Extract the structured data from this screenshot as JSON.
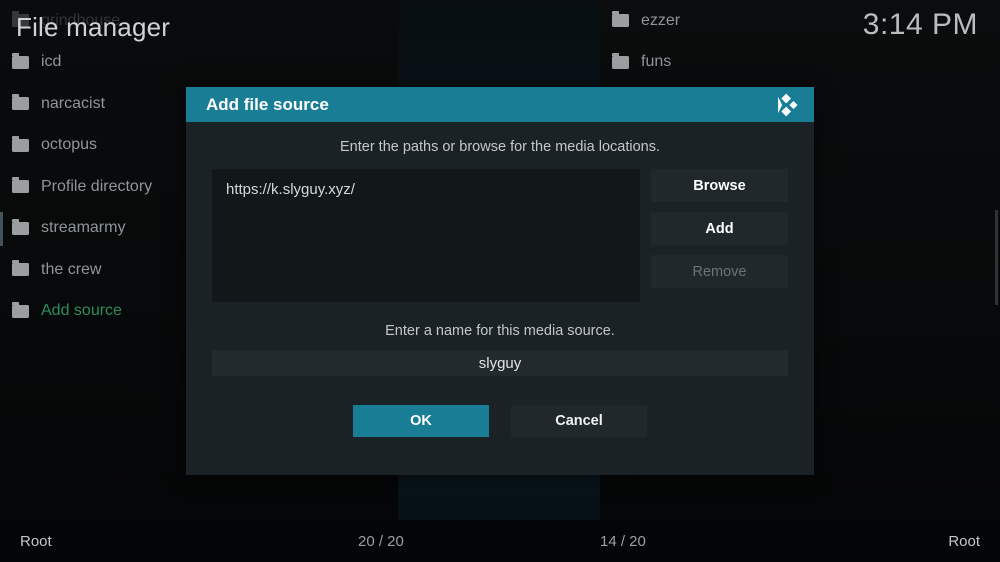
{
  "app": {
    "page_title": "File manager",
    "clock": "3:14 PM",
    "accent_color": "#1a7d96",
    "dialog_bg": "#1b2225",
    "add_source_color": "#2f8d5b"
  },
  "left_panel": {
    "items": [
      {
        "label": "grindhouse",
        "icon": "folder-icon",
        "state": "dimmed"
      },
      {
        "label": "icd",
        "icon": "folder-icon",
        "state": "normal"
      },
      {
        "label": "narcacist",
        "icon": "folder-icon",
        "state": "normal"
      },
      {
        "label": "octopus",
        "icon": "folder-icon",
        "state": "normal"
      },
      {
        "label": "Profile directory",
        "icon": "folder-icon",
        "state": "normal"
      },
      {
        "label": "streamarmy",
        "icon": "folder-icon",
        "state": "selected"
      },
      {
        "label": "the crew",
        "icon": "folder-icon",
        "state": "normal"
      },
      {
        "label": "Add source",
        "icon": "folder-icon",
        "state": "add"
      }
    ]
  },
  "right_panel": {
    "items": [
      {
        "label": "ezzer",
        "icon": "folder-icon"
      },
      {
        "label": "funs",
        "icon": "folder-icon"
      }
    ]
  },
  "statusbar": {
    "left_path": "Root",
    "left_count": "20 / 20",
    "right_count": "14 / 20",
    "right_path": "Root"
  },
  "dialog": {
    "title": "Add file source",
    "logo": "kodi-logo-icon",
    "hint_paths": "Enter the paths or browse for the media locations.",
    "path_value": "https://k.slyguy.xyz/",
    "buttons": {
      "browse": "Browse",
      "add": "Add",
      "remove": "Remove"
    },
    "hint_name": "Enter a name for this media source.",
    "name_value": "slyguy",
    "actions": {
      "ok": "OK",
      "cancel": "Cancel"
    }
  }
}
